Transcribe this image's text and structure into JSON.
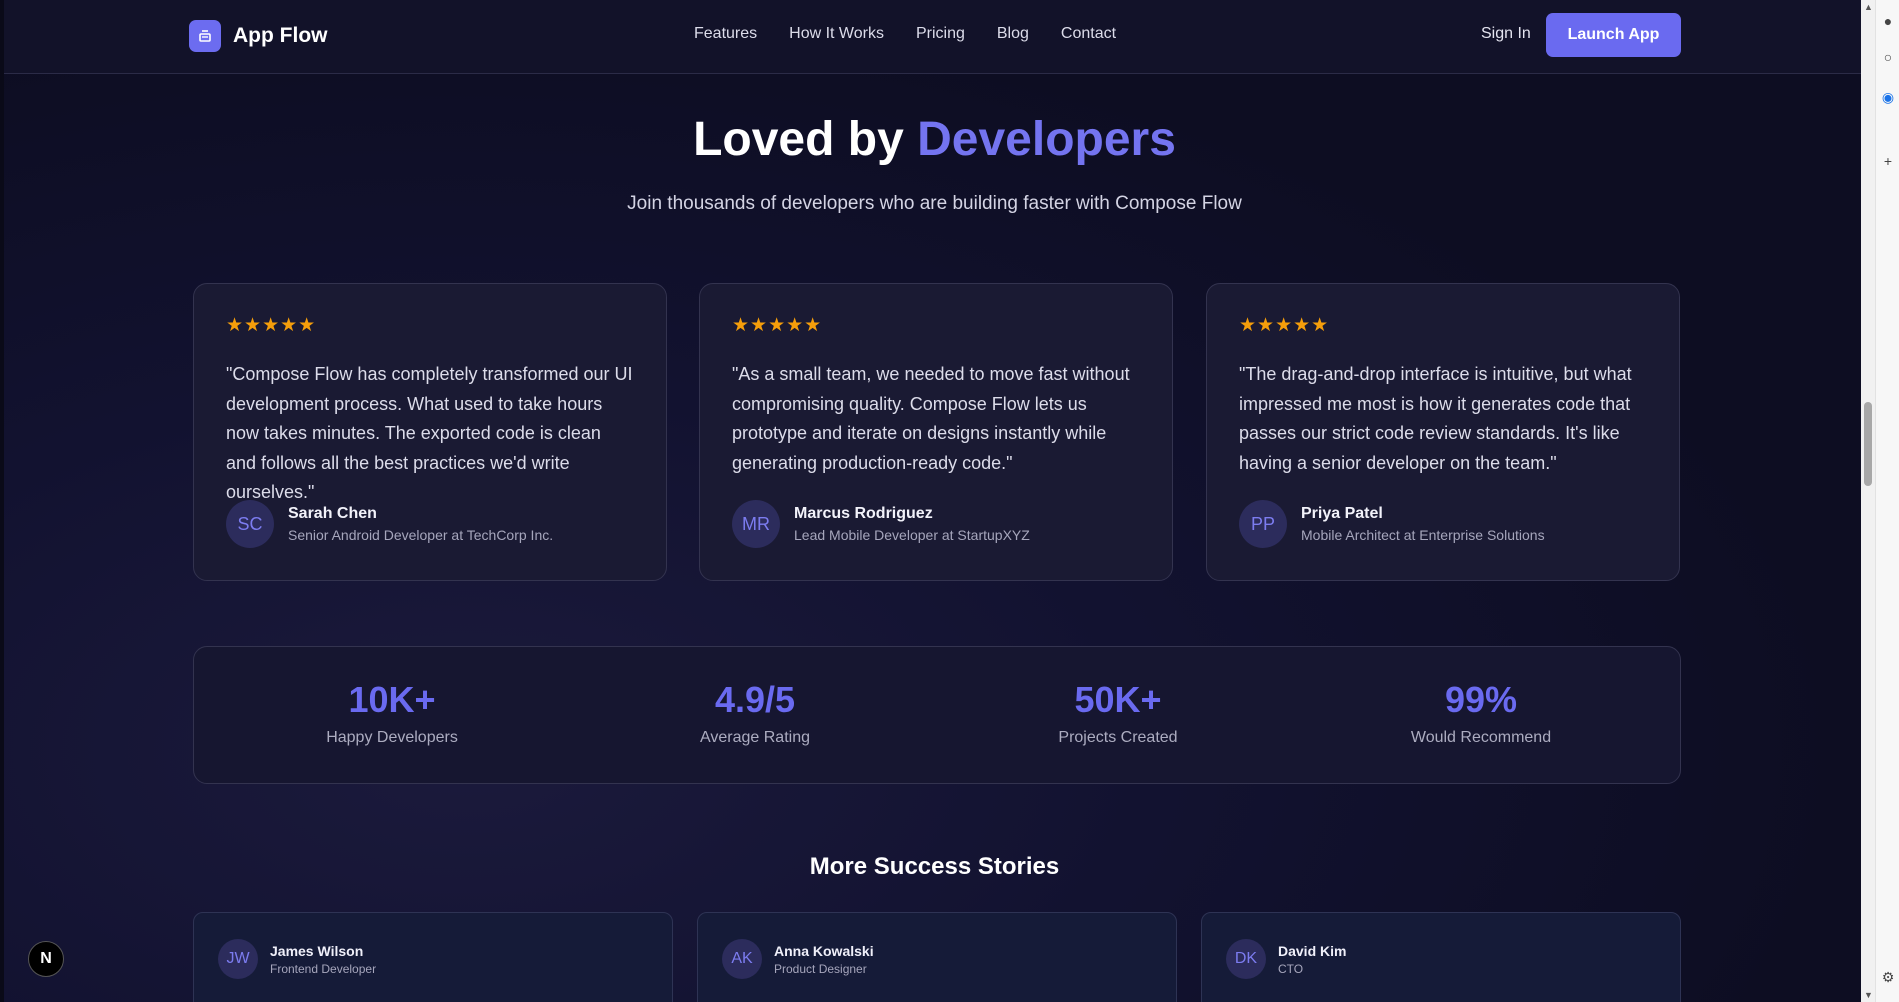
{
  "nav": {
    "brand": "App Flow",
    "links": [
      "Features",
      "How It Works",
      "Pricing",
      "Blog",
      "Contact"
    ],
    "sign_in": "Sign In",
    "launch": "Launch App"
  },
  "hero": {
    "title_prefix": "Loved by",
    "title_accent": "Developers",
    "subtitle": "Join thousands of developers who are building faster with Compose Flow"
  },
  "testimonials": [
    {
      "stars": "★★★★★",
      "quote": "\"Compose Flow has completely transformed our UI development process. What used to take hours now takes minutes. The exported code is clean and follows all the best practices we'd write ourselves.\"",
      "initials": "SC",
      "name": "Sarah Chen",
      "role": "Senior Android Developer at TechCorp Inc."
    },
    {
      "stars": "★★★★★",
      "quote": "\"As a small team, we needed to move fast without compromising quality. Compose Flow lets us prototype and iterate on designs instantly while generating production-ready code.\"",
      "initials": "MR",
      "name": "Marcus Rodriguez",
      "role": "Lead Mobile Developer at StartupXYZ"
    },
    {
      "stars": "★★★★★",
      "quote": "\"The drag-and-drop interface is intuitive, but what impressed me most is how it generates code that passes our strict code review standards. It's like having a senior developer on the team.\"",
      "initials": "PP",
      "name": "Priya Patel",
      "role": "Mobile Architect at Enterprise Solutions"
    }
  ],
  "stats": [
    {
      "value": "10K+",
      "label": "Happy Developers"
    },
    {
      "value": "4.9/5",
      "label": "Average Rating"
    },
    {
      "value": "50K+",
      "label": "Projects Created"
    },
    {
      "value": "99%",
      "label": "Would Recommend"
    }
  ],
  "more": {
    "title": "More Success Stories",
    "stories": [
      {
        "initials": "JW",
        "name": "James Wilson",
        "role": "Frontend Developer"
      },
      {
        "initials": "AK",
        "name": "Anna Kowalski",
        "role": "Product Designer"
      },
      {
        "initials": "DK",
        "name": "David Kim",
        "role": "CTO"
      }
    ]
  },
  "badge": "N",
  "colors": {
    "accent": "#6a6af0",
    "star": "#f59e0b",
    "background": "#0d0d22"
  }
}
